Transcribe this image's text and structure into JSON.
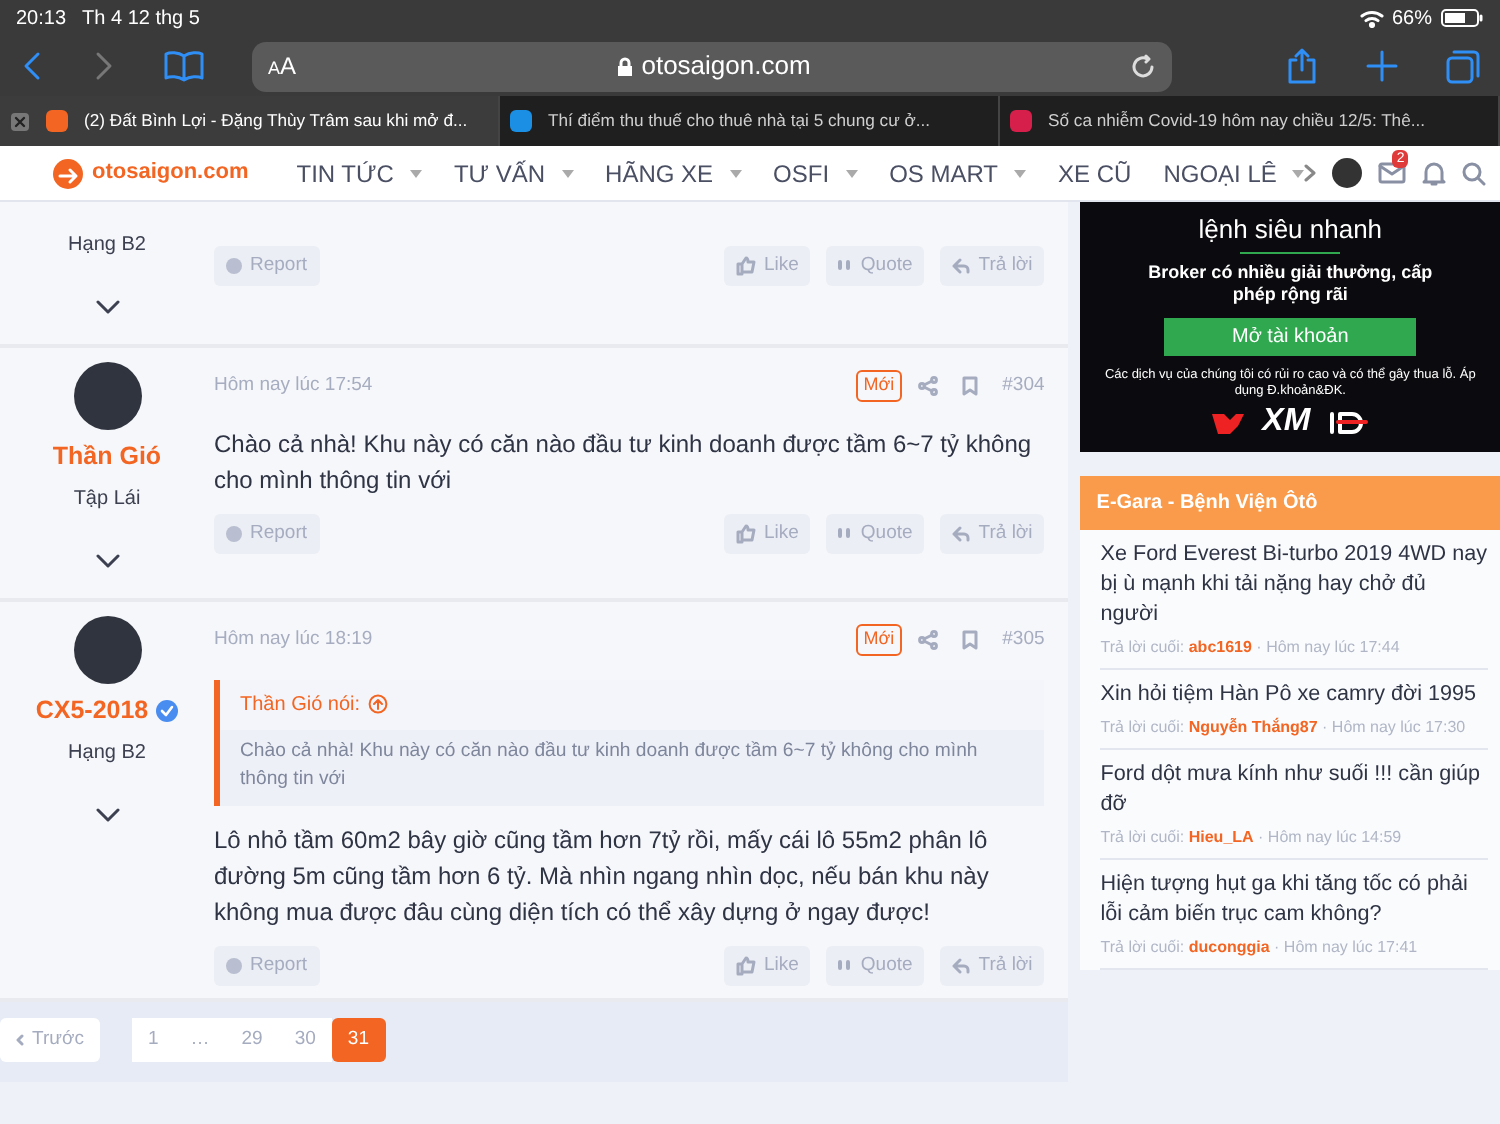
{
  "status_bar": {
    "time": "20:13",
    "date": "Th 4 12 thg 5",
    "battery": "66%"
  },
  "browser": {
    "text_size": "AA",
    "address": "otosaigon.com",
    "tabs": [
      {
        "title": "(2) Đất Bình Lợi - Đặng Thùy Trâm sau khi mở đ...",
        "selected": true,
        "color": "#f26522"
      },
      {
        "title": "Thí điểm thu thuế cho thuê nhà tại 5 chung cư ở...",
        "selected": false,
        "color": "#1a8fe3"
      },
      {
        "title": "Số ca nhiễm Covid-19 hôm nay chiều 12/5: Thê...",
        "selected": false,
        "color": "#d6204b"
      }
    ]
  },
  "site_nav": {
    "logo": "otosaigon.com",
    "menu": [
      {
        "label": "TIN TỨC",
        "has_menu": true
      },
      {
        "label": "TƯ VẤN",
        "has_menu": true
      },
      {
        "label": "HÃNG XE",
        "has_menu": true
      },
      {
        "label": "OSFI",
        "has_menu": true
      },
      {
        "label": "OS MART",
        "has_menu": true
      },
      {
        "label": "XE CŨ",
        "has_menu": false
      },
      {
        "label": "NGOẠI LÊ",
        "has_menu": true
      }
    ],
    "inbox_count": "2"
  },
  "posts": [
    {
      "rank": "Hạng B2",
      "actions": {
        "report": "Report",
        "like": "Like",
        "quote": "Quote",
        "reply": "Trả lời"
      }
    },
    {
      "time": "Hôm nay lúc 17:54",
      "new_label": "Mới",
      "number": "#304",
      "author": "Thần Gió",
      "verified": false,
      "rank": "Tập Lái",
      "text": "Chào cả nhà! Khu này có căn nào đầu tư kinh doanh được tầm 6~7 tỷ không cho mình thông tin với",
      "actions": {
        "report": "Report",
        "like": "Like",
        "quote": "Quote",
        "reply": "Trả lời"
      }
    },
    {
      "time": "Hôm nay lúc 18:19",
      "new_label": "Mới",
      "number": "#305",
      "author": "CX5-2018",
      "verified": true,
      "rank": "Hạng B2",
      "quote": {
        "author": "Thần Gió nói:",
        "text": "Chào cả nhà! Khu này có căn nào đầu tư kinh doanh được tầm 6~7 tỷ không cho mình thông tin với"
      },
      "text": "Lô nhỏ tầm 60m2 bây giờ cũng tầm hơn 7tỷ rồi, mấy cái lô 55m2 phân lô đường 5m cũng tầm hơn 6 tỷ. Mà nhìn ngang nhìn dọc, nếu bán khu này không mua được đâu cùng diện tích có thể xây dựng ở ngay được!",
      "actions": {
        "report": "Report",
        "like": "Like",
        "quote": "Quote",
        "reply": "Trả lời"
      }
    }
  ],
  "pagination": {
    "prev": "Trước",
    "pages": [
      {
        "label": "1",
        "selected": false
      },
      {
        "label": "…",
        "selected": false
      },
      {
        "label": "29",
        "selected": false
      },
      {
        "label": "30",
        "selected": false
      },
      {
        "label": "31",
        "selected": true
      }
    ]
  },
  "ad": {
    "headline": "lệnh siêu nhanh",
    "subline": "Broker có nhiều giải thưởng, cấp phép rộng rãi",
    "button": "Mở tài khoản",
    "disclaimer": "Các dịch vụ của chúng tôi có rủi ro cao và có thể gây thua lỗ. Áp dụng Đ.khoản&ĐK.",
    "brand": "XM"
  },
  "threads": {
    "title": "E-Gara - Bệnh Viện Ôtô",
    "items": [
      {
        "title": "Xe Ford Everest Bi-turbo 2019 4WD nay bị ù mạnh khi tải nặng hay chở đủ người",
        "last_label": "Trả lời cuối:",
        "user": "abc1619",
        "separator": "·",
        "time": "Hôm nay lúc 17:44"
      },
      {
        "title": "Xin hỏi tiệm Hàn Pô xe camry đời 1995",
        "last_label": "Trả lời cuối:",
        "user": "Nguyễn Thắng87",
        "separator": "·",
        "time": "Hôm nay lúc 17:30"
      },
      {
        "title": "Ford dột mưa kính như suối !!! cần giúp đỡ",
        "last_label": "Trả lời cuối:",
        "user": "Hieu_LA",
        "separator": "·",
        "time": "Hôm nay lúc 14:59"
      },
      {
        "title": "Hiện tượng hụt ga khi tăng tốc có phải lỗi cảm biến trục cam không?",
        "last_label": "Trả lời cuối:",
        "user": "duconggia",
        "separator": "·",
        "time": "Hôm nay lúc 17:41"
      }
    ]
  }
}
